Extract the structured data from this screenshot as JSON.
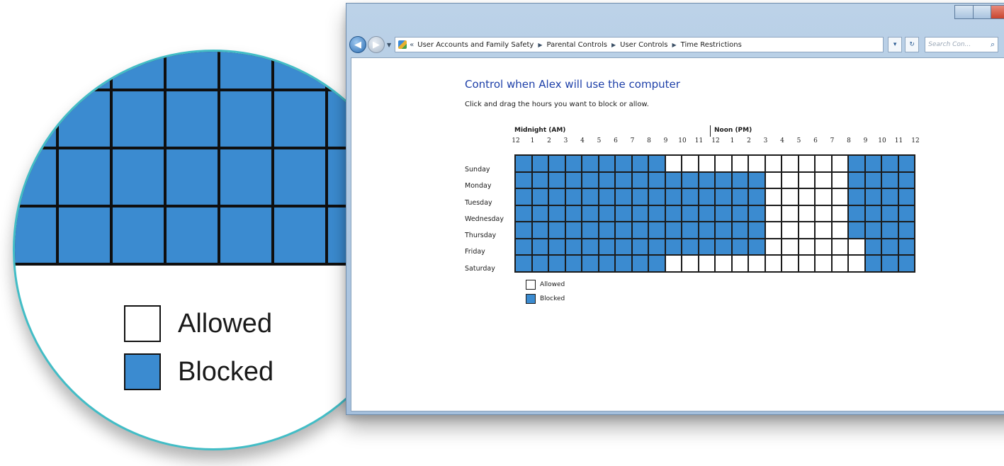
{
  "window": {
    "breadcrumb_lead": "«",
    "breadcrumb": [
      "User Accounts and Family Safety",
      "Parental Controls",
      "User Controls",
      "Time Restrictions"
    ],
    "search_placeholder": "Search Con...",
    "refresh_glyph": "↻",
    "dropdown_glyph": "▾"
  },
  "page": {
    "heading": "Control when Alex will use the computer",
    "instruction": "Click and drag the hours you want to block or allow."
  },
  "schedule": {
    "midnight_label": "Midnight (AM)",
    "noon_label": "Noon (PM)",
    "hour_labels": [
      "12",
      "1",
      "2",
      "3",
      "4",
      "5",
      "6",
      "7",
      "8",
      "9",
      "10",
      "11",
      "12",
      "1",
      "2",
      "3",
      "4",
      "5",
      "6",
      "7",
      "8",
      "9",
      "10",
      "11",
      "12"
    ],
    "days": [
      "Sunday",
      "Monday",
      "Tuesday",
      "Wednesday",
      "Thursday",
      "Friday",
      "Saturday"
    ],
    "blocked_colour": "#3b8bd0",
    "allowed_colour": "#ffffff",
    "blocked_rows": [
      "111111111000000000001111",
      "111111111111111000001111",
      "111111111111111000001111",
      "111111111111111000001111",
      "111111111111111000001111",
      "111111111111111000000111",
      "111111111000000000000111"
    ]
  },
  "legend": {
    "allowed": "Allowed",
    "blocked": "Blocked"
  },
  "magnifier": {
    "allowed": "Allowed",
    "blocked": "Blocked",
    "accent_colour": "#42bdc6"
  }
}
